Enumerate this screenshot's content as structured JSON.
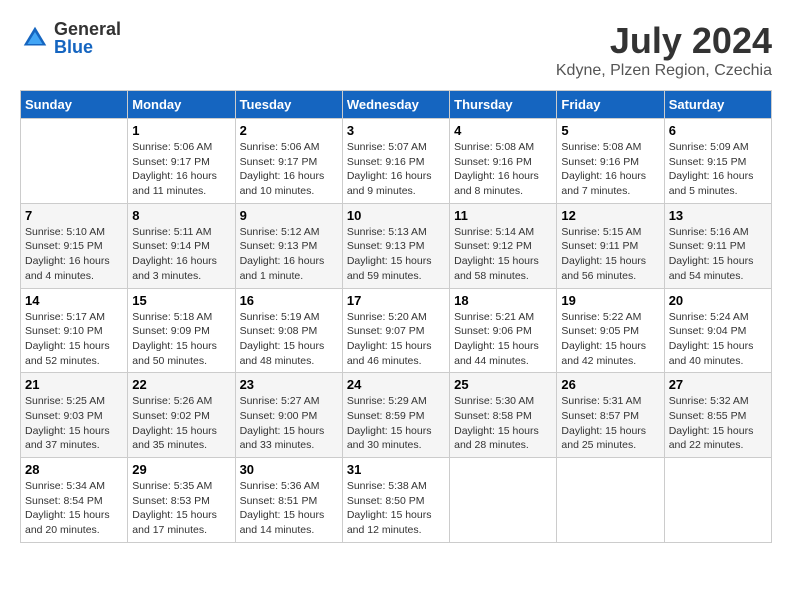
{
  "header": {
    "logo_general": "General",
    "logo_blue": "Blue",
    "month_year": "July 2024",
    "location": "Kdyne, Plzen Region, Czechia"
  },
  "columns": [
    "Sunday",
    "Monday",
    "Tuesday",
    "Wednesday",
    "Thursday",
    "Friday",
    "Saturday"
  ],
  "weeks": [
    [
      {
        "day": "",
        "info": ""
      },
      {
        "day": "1",
        "info": "Sunrise: 5:06 AM\nSunset: 9:17 PM\nDaylight: 16 hours\nand 11 minutes."
      },
      {
        "day": "2",
        "info": "Sunrise: 5:06 AM\nSunset: 9:17 PM\nDaylight: 16 hours\nand 10 minutes."
      },
      {
        "day": "3",
        "info": "Sunrise: 5:07 AM\nSunset: 9:16 PM\nDaylight: 16 hours\nand 9 minutes."
      },
      {
        "day": "4",
        "info": "Sunrise: 5:08 AM\nSunset: 9:16 PM\nDaylight: 16 hours\nand 8 minutes."
      },
      {
        "day": "5",
        "info": "Sunrise: 5:08 AM\nSunset: 9:16 PM\nDaylight: 16 hours\nand 7 minutes."
      },
      {
        "day": "6",
        "info": "Sunrise: 5:09 AM\nSunset: 9:15 PM\nDaylight: 16 hours\nand 5 minutes."
      }
    ],
    [
      {
        "day": "7",
        "info": "Sunrise: 5:10 AM\nSunset: 9:15 PM\nDaylight: 16 hours\nand 4 minutes."
      },
      {
        "day": "8",
        "info": "Sunrise: 5:11 AM\nSunset: 9:14 PM\nDaylight: 16 hours\nand 3 minutes."
      },
      {
        "day": "9",
        "info": "Sunrise: 5:12 AM\nSunset: 9:13 PM\nDaylight: 16 hours\nand 1 minute."
      },
      {
        "day": "10",
        "info": "Sunrise: 5:13 AM\nSunset: 9:13 PM\nDaylight: 15 hours\nand 59 minutes."
      },
      {
        "day": "11",
        "info": "Sunrise: 5:14 AM\nSunset: 9:12 PM\nDaylight: 15 hours\nand 58 minutes."
      },
      {
        "day": "12",
        "info": "Sunrise: 5:15 AM\nSunset: 9:11 PM\nDaylight: 15 hours\nand 56 minutes."
      },
      {
        "day": "13",
        "info": "Sunrise: 5:16 AM\nSunset: 9:11 PM\nDaylight: 15 hours\nand 54 minutes."
      }
    ],
    [
      {
        "day": "14",
        "info": "Sunrise: 5:17 AM\nSunset: 9:10 PM\nDaylight: 15 hours\nand 52 minutes."
      },
      {
        "day": "15",
        "info": "Sunrise: 5:18 AM\nSunset: 9:09 PM\nDaylight: 15 hours\nand 50 minutes."
      },
      {
        "day": "16",
        "info": "Sunrise: 5:19 AM\nSunset: 9:08 PM\nDaylight: 15 hours\nand 48 minutes."
      },
      {
        "day": "17",
        "info": "Sunrise: 5:20 AM\nSunset: 9:07 PM\nDaylight: 15 hours\nand 46 minutes."
      },
      {
        "day": "18",
        "info": "Sunrise: 5:21 AM\nSunset: 9:06 PM\nDaylight: 15 hours\nand 44 minutes."
      },
      {
        "day": "19",
        "info": "Sunrise: 5:22 AM\nSunset: 9:05 PM\nDaylight: 15 hours\nand 42 minutes."
      },
      {
        "day": "20",
        "info": "Sunrise: 5:24 AM\nSunset: 9:04 PM\nDaylight: 15 hours\nand 40 minutes."
      }
    ],
    [
      {
        "day": "21",
        "info": "Sunrise: 5:25 AM\nSunset: 9:03 PM\nDaylight: 15 hours\nand 37 minutes."
      },
      {
        "day": "22",
        "info": "Sunrise: 5:26 AM\nSunset: 9:02 PM\nDaylight: 15 hours\nand 35 minutes."
      },
      {
        "day": "23",
        "info": "Sunrise: 5:27 AM\nSunset: 9:00 PM\nDaylight: 15 hours\nand 33 minutes."
      },
      {
        "day": "24",
        "info": "Sunrise: 5:29 AM\nSunset: 8:59 PM\nDaylight: 15 hours\nand 30 minutes."
      },
      {
        "day": "25",
        "info": "Sunrise: 5:30 AM\nSunset: 8:58 PM\nDaylight: 15 hours\nand 28 minutes."
      },
      {
        "day": "26",
        "info": "Sunrise: 5:31 AM\nSunset: 8:57 PM\nDaylight: 15 hours\nand 25 minutes."
      },
      {
        "day": "27",
        "info": "Sunrise: 5:32 AM\nSunset: 8:55 PM\nDaylight: 15 hours\nand 22 minutes."
      }
    ],
    [
      {
        "day": "28",
        "info": "Sunrise: 5:34 AM\nSunset: 8:54 PM\nDaylight: 15 hours\nand 20 minutes."
      },
      {
        "day": "29",
        "info": "Sunrise: 5:35 AM\nSunset: 8:53 PM\nDaylight: 15 hours\nand 17 minutes."
      },
      {
        "day": "30",
        "info": "Sunrise: 5:36 AM\nSunset: 8:51 PM\nDaylight: 15 hours\nand 14 minutes."
      },
      {
        "day": "31",
        "info": "Sunrise: 5:38 AM\nSunset: 8:50 PM\nDaylight: 15 hours\nand 12 minutes."
      },
      {
        "day": "",
        "info": ""
      },
      {
        "day": "",
        "info": ""
      },
      {
        "day": "",
        "info": ""
      }
    ]
  ]
}
